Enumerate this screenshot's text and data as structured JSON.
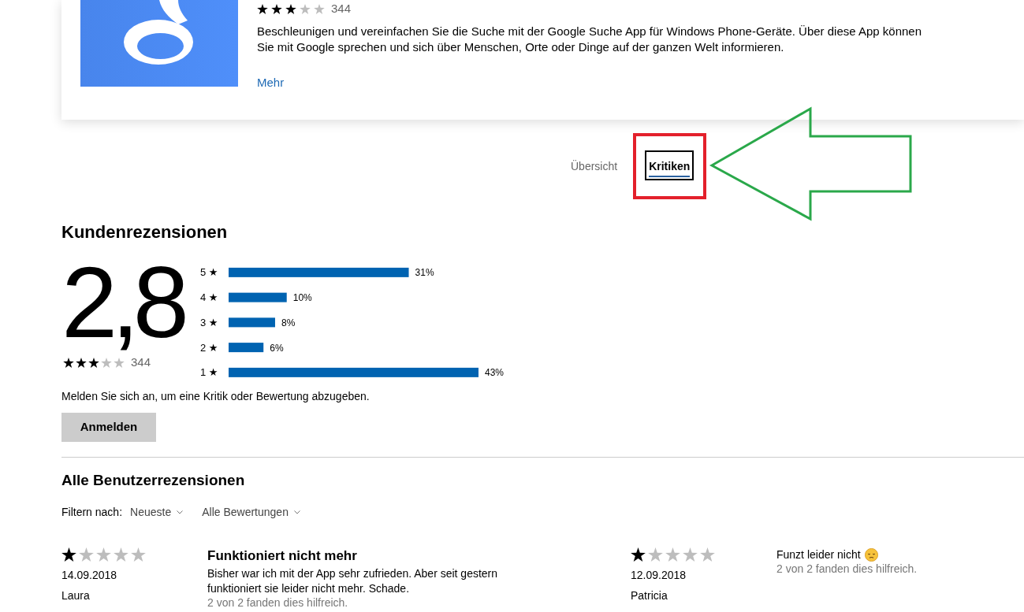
{
  "app_card": {
    "stars": 3,
    "rating_count": "344",
    "description": "Beschleunigen und vereinfachen Sie die Suche mit der Google Suche App für Windows Phone-Geräte. Über diese App können Sie mit Google sprechen und sich über Menschen, Orte oder Dinge auf der ganzen Welt informieren.",
    "more_link": "Mehr"
  },
  "tabs": [
    {
      "label": "Übersicht",
      "selected": false,
      "focused": false
    },
    {
      "label": "Kritiken",
      "selected": true,
      "focused": true
    }
  ],
  "summary": {
    "title": "Kundenrezensionen",
    "average": "2,8",
    "stars": 3,
    "rating_count": "344",
    "chart_data": {
      "type": "bar",
      "orientation": "horizontal",
      "categories": [
        "5 ★",
        "4 ★",
        "3 ★",
        "2 ★",
        "1 ★"
      ],
      "values": [
        31,
        10,
        8,
        6,
        43
      ],
      "value_labels": [
        "31%",
        "10%",
        "8%",
        "6%",
        "43%"
      ]
    },
    "sign_in_prompt": "Melden Sie sich an, um eine Kritik oder Bewertung abzugeben.",
    "sign_in_button": "Anmelden"
  },
  "reviews_section": {
    "title": "Alle Benutzerrezensionen",
    "filter_label": "Filtern nach:",
    "filters": [
      {
        "value": "Neueste"
      },
      {
        "value": "Alle Bewertungen"
      }
    ]
  },
  "reviews": [
    {
      "stars": 1,
      "date": "14.09.2018",
      "author": "Laura",
      "title": "Funktioniert nicht mehr",
      "body": "Bisher war ich mit der App sehr zufrieden. Aber seit gestern funktioniert sie leider nicht mehr. Schade.",
      "emoji": false,
      "helpful": "2 von 2 fanden dies hilfreich."
    },
    {
      "stars": 1,
      "date": "12.09.2018",
      "author": "Patricia",
      "body": "Funzt leider nicht",
      "emoji": true,
      "helpful": "2 von 2 fanden dies hilfreich."
    }
  ]
}
